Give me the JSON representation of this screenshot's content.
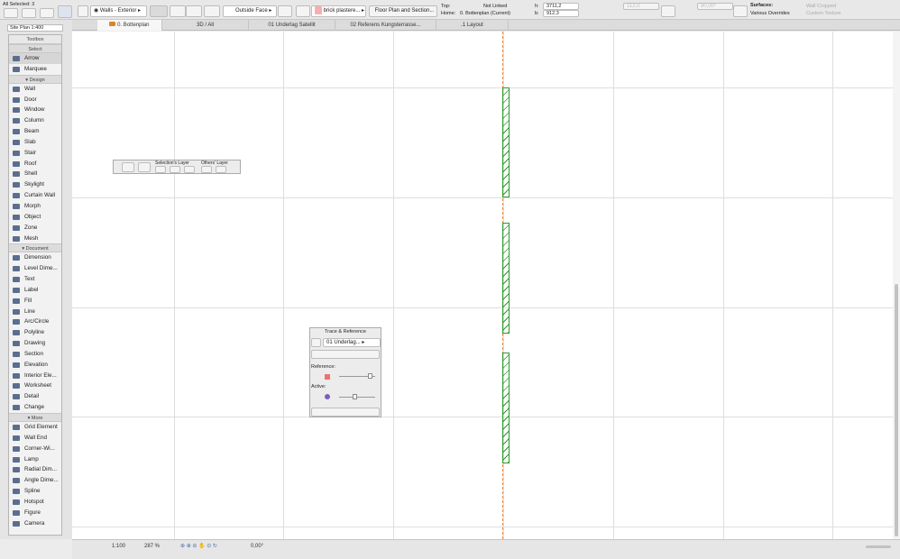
{
  "toolbar": {
    "selection_info": "All Selected: 3",
    "layer": "Walls - Exterior",
    "reference_line": "Outside Face",
    "material": "brick plastere...",
    "floor_plan_section": "Floor Plan and Section...",
    "top_label": "Top:",
    "top_value": "Not Linked",
    "home_label": "Home:",
    "home_value": "0. Bottenplan (Current)",
    "height_label": "h:",
    "height_value": "3711,2",
    "bottom_label": "b:",
    "bottom_value": "912,3",
    "thickness_value": "112,0",
    "angle_value": "90,00°",
    "surfaces_label": "Surfaces:",
    "surfaces_value": "Various Overrides",
    "wall_cropped": "Wall Cropped",
    "custom_texture": "Custom Texture"
  },
  "view_selector": "Site Plan 1:400",
  "tabs": [
    {
      "label": "0. Bottenplan"
    },
    {
      "label": "3D / All"
    },
    {
      "label": "01 Underlag Satellit"
    },
    {
      "label": "02 Referens Kungsterrasse..."
    },
    {
      "label": ".1 Layout"
    }
  ],
  "toolbox": {
    "title": "Toolbox",
    "select_header": "Select",
    "select_items": [
      "Arrow",
      "Marquee"
    ],
    "design_header": "Design",
    "design_items": [
      "Wall",
      "Door",
      "Window",
      "Column",
      "Beam",
      "Slab",
      "Stair",
      "Roof",
      "Shell",
      "Skylight",
      "Curtain Wall",
      "Morph",
      "Object",
      "Zone",
      "Mesh"
    ],
    "document_header": "Document",
    "document_items": [
      "Dimension",
      "Level Dime...",
      "Text",
      "Label",
      "Fill",
      "Line",
      "Arc/Circle",
      "Polyline",
      "Drawing",
      "Section",
      "Elevation",
      "Interior Ele...",
      "Worksheet",
      "Detail",
      "Change"
    ],
    "more_header": "More",
    "more_items": [
      "Grid Element",
      "Wall End",
      "Corner-Wi...",
      "Lamp",
      "Radial Dim...",
      "Angle Dime...",
      "Spline",
      "Hotspot",
      "Figure",
      "Camera"
    ]
  },
  "layer_palette": {
    "selections_layer": "Selection's Layer",
    "others_layer": "Others' Layer"
  },
  "trace_palette": {
    "title": "Trace & Reference",
    "reference_source": "01 Underlag...",
    "reference_label": "Reference:",
    "active_label": "Active:",
    "reference_slider": 0.85,
    "active_slider": 0.4
  },
  "status_bar": {
    "scale": "1:100",
    "zoom": "287 %",
    "angle": "0,00°"
  },
  "colors": {
    "wall": "#2e9a2e",
    "reference_line": "#f08a3c"
  }
}
